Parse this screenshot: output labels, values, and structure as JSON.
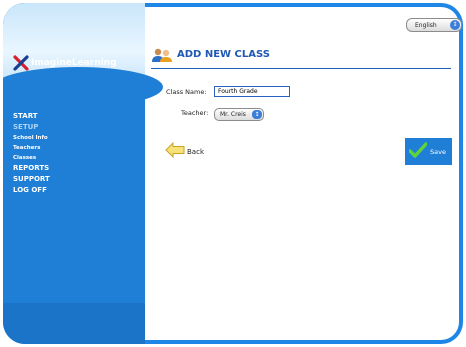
{
  "app": {
    "logo_text": "ImagineLearning"
  },
  "nav": [
    {
      "label": "START",
      "type": "main"
    },
    {
      "label": "SETUP",
      "type": "main-dim"
    },
    {
      "label": "School Info",
      "type": "sub"
    },
    {
      "label": "Teachers",
      "type": "sub"
    },
    {
      "label": "Classes",
      "type": "sub"
    },
    {
      "label": "REPORTS",
      "type": "main"
    },
    {
      "label": "SUPPORT",
      "type": "main"
    },
    {
      "label": "LOG OFF",
      "type": "main"
    }
  ],
  "language_select": {
    "value": "English"
  },
  "page_title": "ADD NEW CLASS",
  "form": {
    "class_name_label": "Class Name:",
    "class_name_value": "Fourth Grade",
    "teacher_label": "Teacher:",
    "teacher_value": "Mr. Creis"
  },
  "actions": {
    "back_label": "Back",
    "save_label": "Save"
  },
  "colors": {
    "sidebar": "#1f7fd6",
    "title": "#1f59b3",
    "accent": "#1e86e6"
  }
}
